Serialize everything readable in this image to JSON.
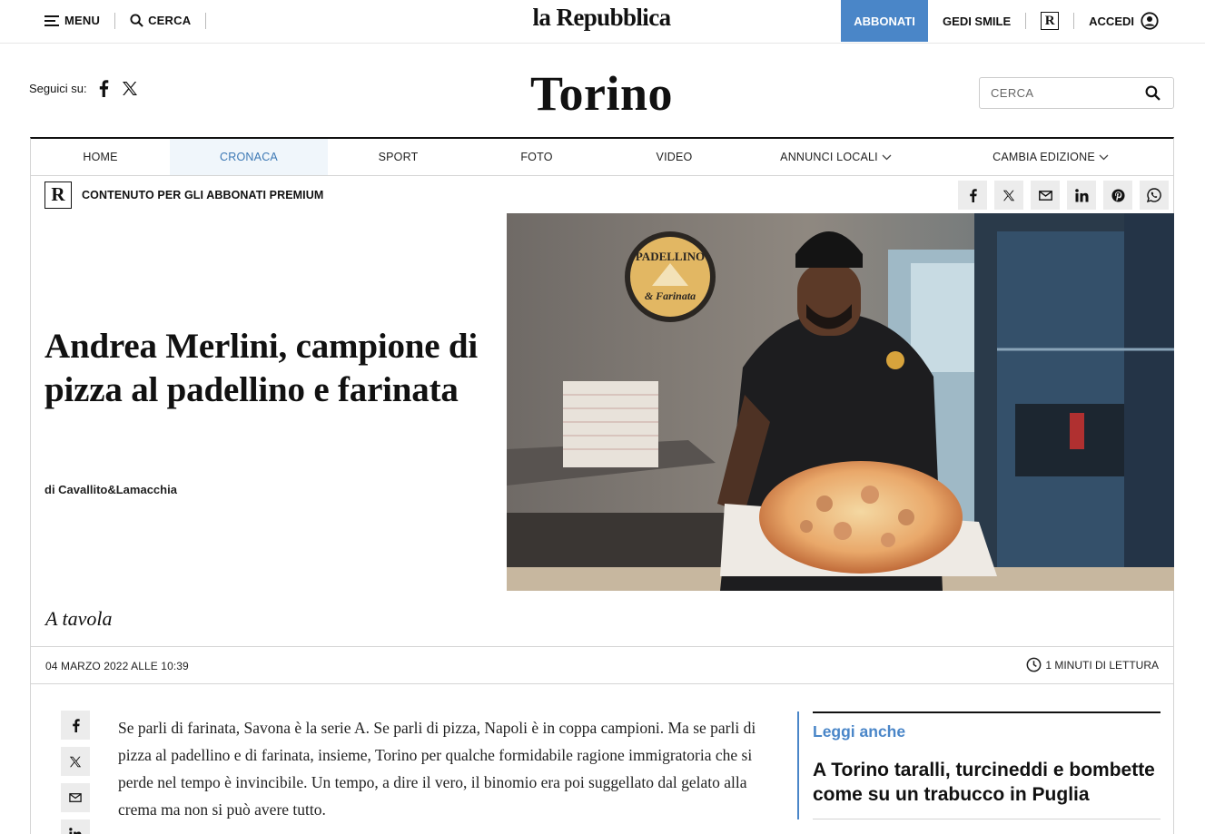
{
  "topbar": {
    "menu_label": "MENU",
    "search_label": "CERCA",
    "logo": "la Repubblica",
    "subscribe_label": "ABBONATI",
    "gedi_label": "GEDI SMILE",
    "r_logo": "R",
    "login_label": "ACCEDI"
  },
  "header": {
    "follow_label": "Seguici su:",
    "city_title": "Torino",
    "search_placeholder": "CERCA"
  },
  "nav": {
    "items": [
      {
        "label": "HOME"
      },
      {
        "label": "CRONACA",
        "active": true
      },
      {
        "label": "SPORT"
      },
      {
        "label": "FOTO"
      },
      {
        "label": "VIDEO"
      },
      {
        "label": "ANNUNCI LOCALI"
      },
      {
        "label": "CAMBIA EDIZIONE"
      }
    ]
  },
  "premium": {
    "badge": "R",
    "label": "CONTENUTO PER GLI ABBONATI PREMIUM"
  },
  "share_icons": [
    "facebook-icon",
    "x-icon",
    "mail-icon",
    "linkedin-icon",
    "pinterest-icon",
    "whatsapp-icon"
  ],
  "article": {
    "headline": "Andrea Merlini, campione di pizza al padellino e farinata",
    "byline": "di Cavallito&Lamacchia",
    "section": "A tavola",
    "date": "04 MARZO 2022 ALLE 10:39",
    "read_time": "1 MINUTI DI LETTURA",
    "body": "Se parli di farinata, Savona è la serie A. Se parli di pizza, Napoli è in coppa campioni. Ma se parli di pizza al padellino e di farinata, insieme, Torino per qualche formidabile ragione immigratoria che si perde nel tempo è invincibile. Un tempo, a dire il vero, il binomio era poi suggellato dal gelato alla crema ma non si può avere tutto.",
    "image_sign": {
      "line1": "PADELLINO",
      "line2": "& Farinata"
    }
  },
  "related": {
    "title": "Leggi anche",
    "link": "A Torino taralli, turcineddi e bombette come su un trabucco in Puglia"
  },
  "colors": {
    "accent": "#4a86c8",
    "nav_active_bg": "#f0f6fb",
    "share_bg": "#ececec"
  }
}
